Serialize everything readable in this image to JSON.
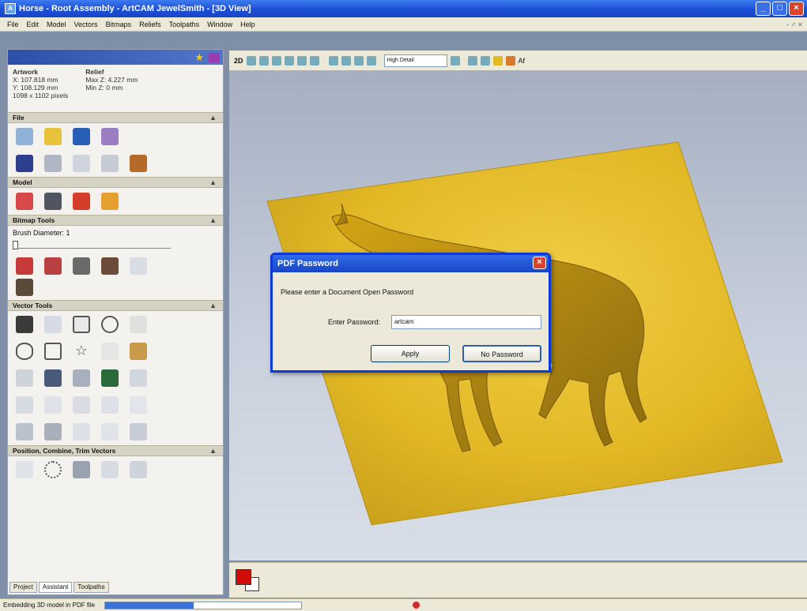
{
  "window": {
    "title": "Horse - Root Assembly - ArtCAM JewelSmith - [3D View]"
  },
  "menu": [
    "File",
    "Edit",
    "Model",
    "Vectors",
    "Bitmaps",
    "Reliefs",
    "Toolpaths",
    "Window",
    "Help"
  ],
  "info": {
    "artwork_label": "Artwork",
    "artwork_x": "X: 107.818 mm",
    "artwork_y": "Y: 108.129 mm",
    "artwork_px": "1098 x 1102 pixels",
    "relief_label": "Relief",
    "relief_max": "Max Z: 4.227 mm",
    "relief_min": "Min Z: 0 mm"
  },
  "sections": {
    "file": "File",
    "model": "Model",
    "bitmap": "Bitmap Tools",
    "brush": "Brush Diameter: 1",
    "vector": "Vector Tools",
    "position": "Position, Combine, Trim Vectors"
  },
  "toolbar3d": {
    "twod": "2D",
    "detail": "High Detail",
    "af": "Af"
  },
  "tabs": [
    "Project",
    "Assistant",
    "Toolpaths"
  ],
  "dialog": {
    "title": "PDF Password",
    "prompt": "Please enter a Document Open Password",
    "pw_label": "Enter Password:",
    "pw_value": "artcam",
    "apply": "Apply",
    "no_password": "No Password"
  },
  "status": {
    "text": "Embedding 3D model in PDF file",
    "progress": 0.45
  },
  "colors": {
    "model_gold": "#e2b826",
    "accent_blue": "#1c4fd6",
    "primary_color": "#d10a0a"
  }
}
